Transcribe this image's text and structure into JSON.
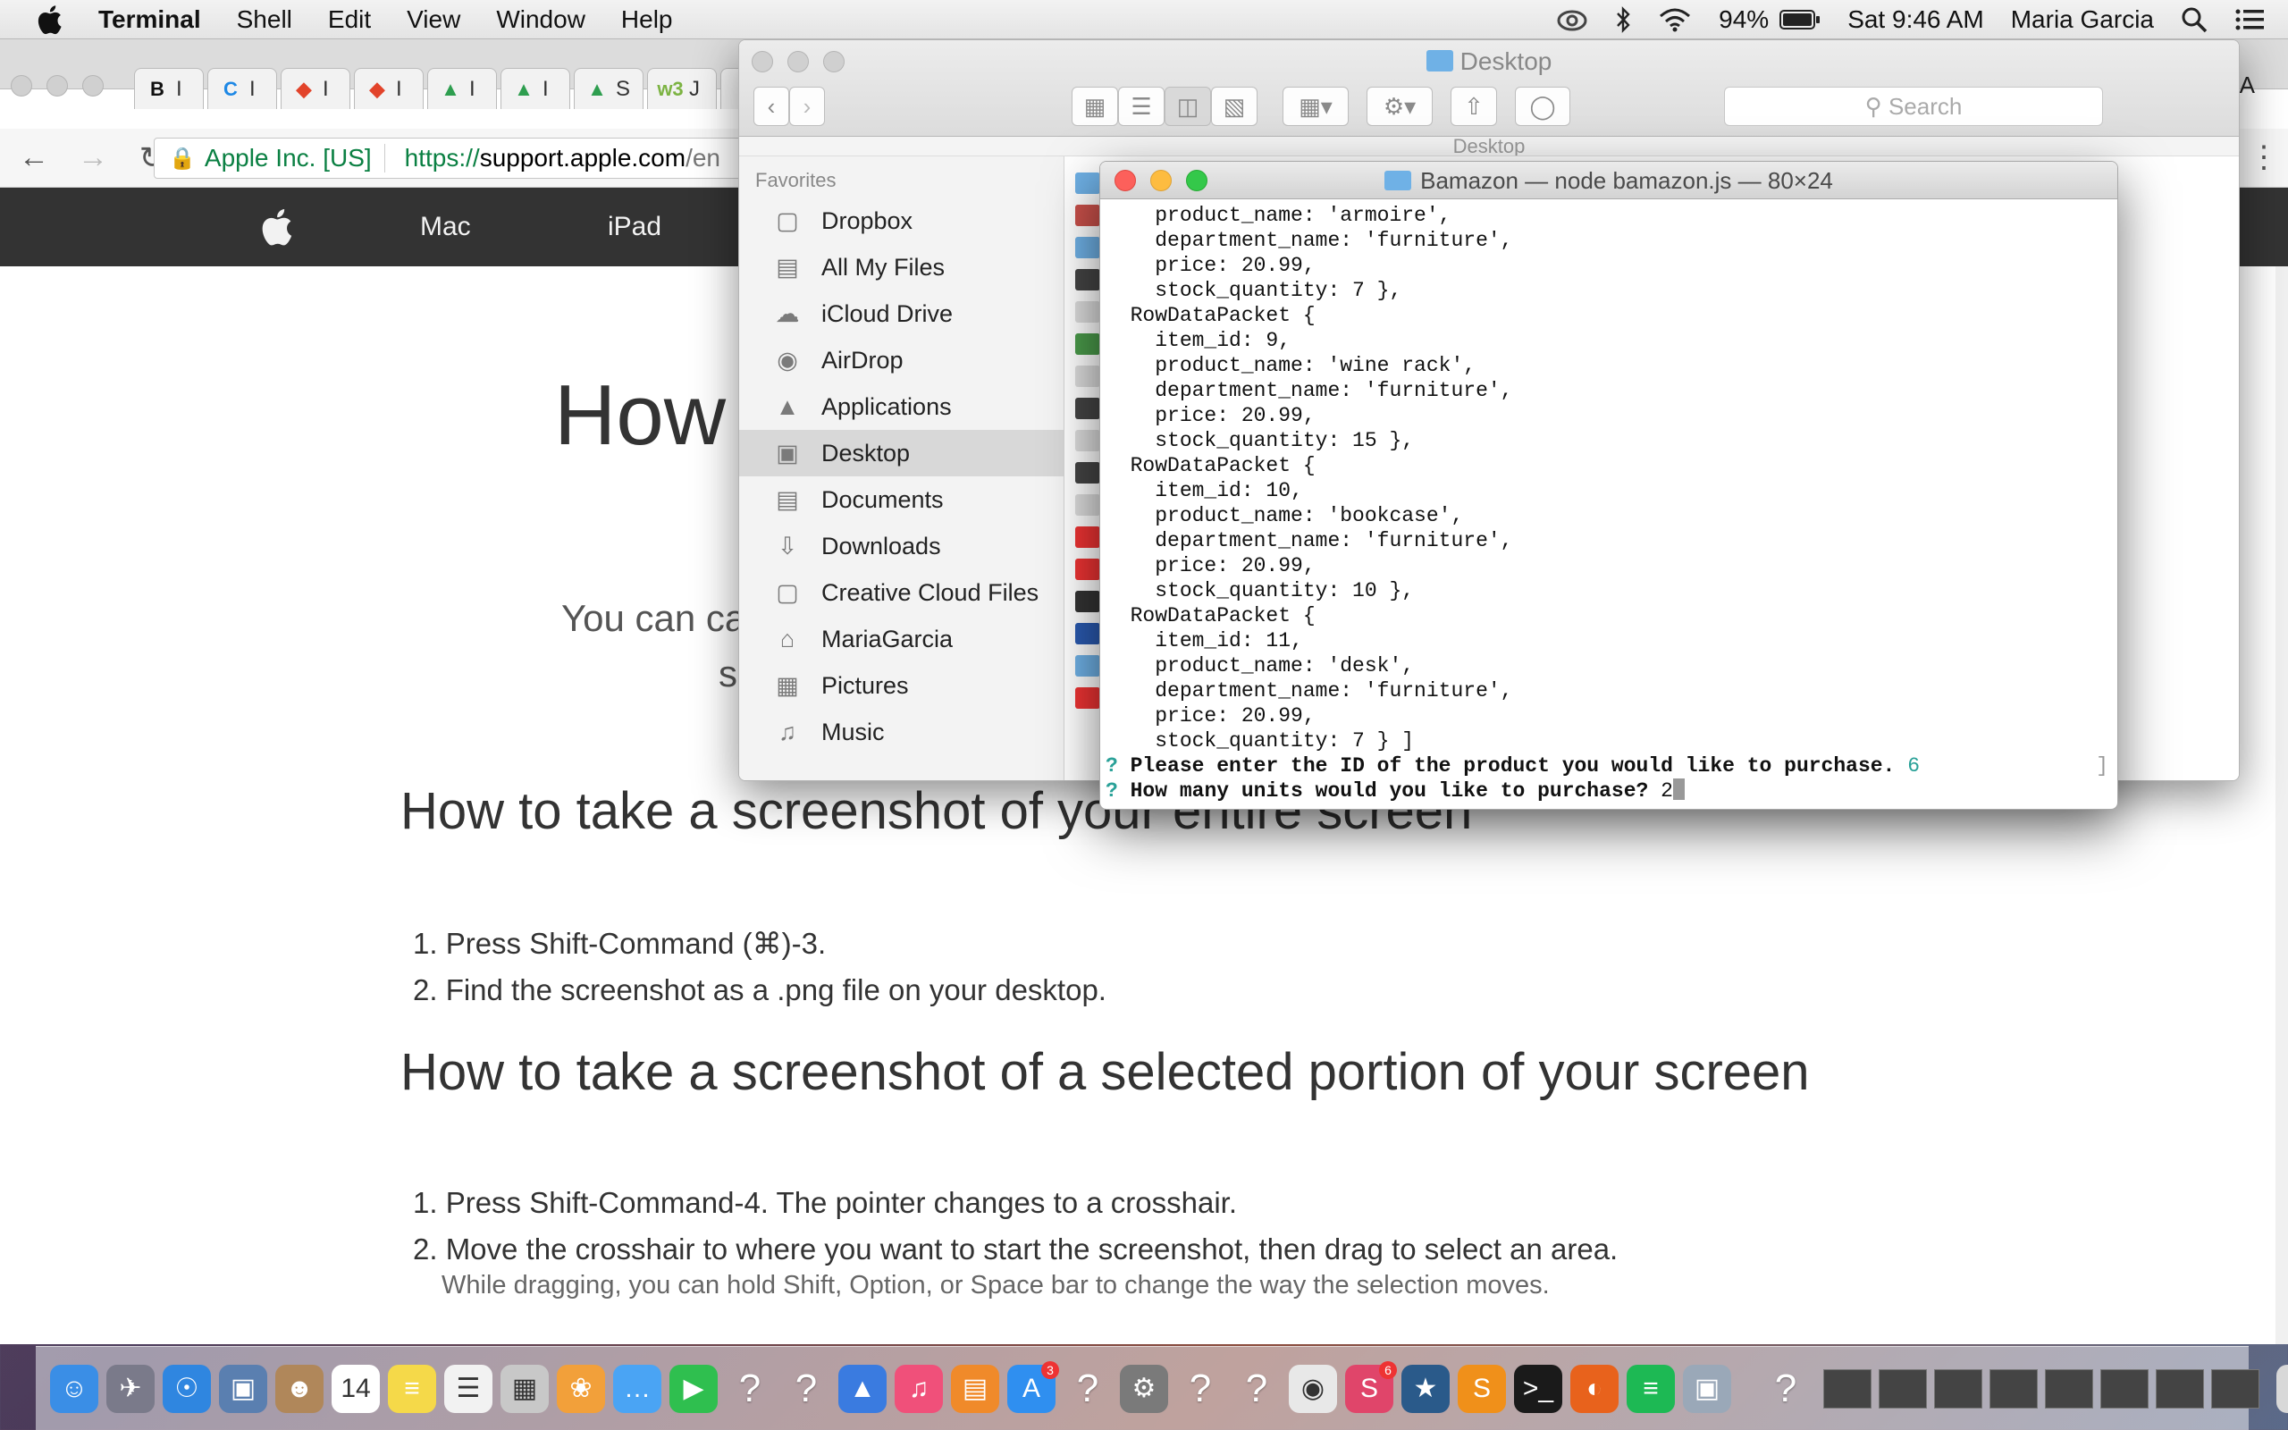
{
  "menubar": {
    "app": "Terminal",
    "menus": [
      "Shell",
      "Edit",
      "View",
      "Window",
      "Help"
    ],
    "battery": "94%",
    "clock": "Sat 9:46 AM",
    "user": "Maria Garcia"
  },
  "browser": {
    "tabs": [
      {
        "glyph": "B",
        "color": "#111111"
      },
      {
        "glyph": "C",
        "color": "#1e88e5"
      },
      {
        "glyph": "◆",
        "color": "#e2432a"
      },
      {
        "glyph": "◆",
        "color": "#e2432a"
      },
      {
        "glyph": "▲",
        "color": "#2e9e4f"
      },
      {
        "glyph": "▲",
        "color": "#2e9e4f"
      },
      {
        "glyph": "▲",
        "color": "#2e9e4f"
      },
      {
        "glyph": "w3",
        "color": "#7cb342"
      },
      {
        "glyph": "▮",
        "color": "#111111"
      }
    ],
    "tab_suffixes": [
      "I",
      "I",
      "I",
      "I",
      "I",
      "I",
      "S",
      "J",
      ""
    ],
    "profile": "MARIA",
    "omnibox": {
      "org": "Apple Inc. [US]",
      "proto": "https://",
      "host": "support.apple.com",
      "path": "/en"
    },
    "applenav": {
      "items": [
        "Mac",
        "iPad"
      ]
    },
    "article": {
      "title": "How",
      "intro_line1": "You can ca",
      "intro_line2": "s",
      "heading1": "How to take a screenshot of your entire screen",
      "list1": [
        "1. Press Shift-Command (⌘)-3.",
        "2. Find the screenshot as a .png file on your desktop."
      ],
      "heading2": "How to take a screenshot of a selected portion of your screen",
      "list2": [
        "1. Press Shift-Command-4. The pointer changes to a crosshair.",
        "2. Move the crosshair to where you want to start the screenshot, then drag to select an area."
      ],
      "note": "While dragging, you can hold Shift, Option, or Space bar to change the way the selection moves."
    }
  },
  "finder": {
    "title": "Desktop",
    "path_label": "Desktop",
    "search_placeholder": "Search",
    "sidebar_header": "Favorites",
    "items": [
      "Dropbox",
      "All My Files",
      "iCloud Drive",
      "AirDrop",
      "Applications",
      "Desktop",
      "Documents",
      "Downloads",
      "Creative Cloud Files",
      "MariaGarcia",
      "Pictures",
      "Music"
    ],
    "selected": "Desktop"
  },
  "terminal": {
    "title": "Bamazon — node bamazon.js — 80×24",
    "lines": [
      "    product_name: 'armoire',",
      "    department_name: 'furniture',",
      "    price: 20.99,",
      "    stock_quantity: 7 },",
      "  RowDataPacket {",
      "    item_id: 9,",
      "    product_name: 'wine rack',",
      "    department_name: 'furniture',",
      "    price: 20.99,",
      "    stock_quantity: 15 },",
      "  RowDataPacket {",
      "    item_id: 10,",
      "    product_name: 'bookcase',",
      "    department_name: 'furniture',",
      "    price: 20.99,",
      "    stock_quantity: 10 },",
      "  RowDataPacket {",
      "    item_id: 11,",
      "    product_name: 'desk',",
      "    department_name: 'furniture',",
      "    price: 20.99,",
      "    stock_quantity: 7 } ]"
    ],
    "prompt1_marker": "?",
    "prompt1_text": "Please enter the ID of the product you would like to purchase.",
    "prompt1_answer": "6",
    "prompt2_marker": "?",
    "prompt2_text": "How many units would you like to purchase?",
    "prompt2_answer": "2"
  },
  "dock": {
    "apps": [
      {
        "name": "finder",
        "glyph": "☺",
        "bg": "#3a8ee6"
      },
      {
        "name": "launchpad",
        "glyph": "✈",
        "bg": "#7a7a8a"
      },
      {
        "name": "safari",
        "glyph": "☉",
        "bg": "#2f86e0"
      },
      {
        "name": "preview",
        "glyph": "▣",
        "bg": "#5a7fb0"
      },
      {
        "name": "contacts",
        "glyph": "☻",
        "bg": "#b0875a"
      },
      {
        "name": "calendar",
        "glyph": "14",
        "bg": "#ffffff"
      },
      {
        "name": "notes",
        "glyph": "≡",
        "bg": "#f5d949"
      },
      {
        "name": "reminders",
        "glyph": "☰",
        "bg": "#f2f2f2"
      },
      {
        "name": "photo-booth",
        "glyph": "▦",
        "bg": "#c8c8c8"
      },
      {
        "name": "photos",
        "glyph": "❀",
        "bg": "#f2a03a"
      },
      {
        "name": "messages",
        "glyph": "…",
        "bg": "#4aa4f4"
      },
      {
        "name": "facetime",
        "glyph": "▶",
        "bg": "#2fbf4f"
      },
      {
        "name": "unknown-1",
        "glyph": "?",
        "bg": "transparent"
      },
      {
        "name": "unknown-2",
        "glyph": "?",
        "bg": "transparent"
      },
      {
        "name": "keynote",
        "glyph": "▲",
        "bg": "#3a7be0"
      },
      {
        "name": "itunes",
        "glyph": "♫",
        "bg": "#f0507a"
      },
      {
        "name": "ibooks",
        "glyph": "▤",
        "bg": "#f08a2a"
      },
      {
        "name": "app-store",
        "glyph": "A",
        "bg": "#2f8ff0",
        "badge": "3"
      },
      {
        "name": "unknown-3",
        "glyph": "?",
        "bg": "transparent"
      },
      {
        "name": "system-preferences",
        "glyph": "⚙",
        "bg": "#7a7a7a"
      },
      {
        "name": "unknown-4",
        "glyph": "?",
        "bg": "transparent"
      },
      {
        "name": "unknown-5",
        "glyph": "?",
        "bg": "transparent"
      },
      {
        "name": "chrome",
        "glyph": "◉",
        "bg": "#e8e8e8"
      },
      {
        "name": "slack",
        "glyph": "S",
        "bg": "#e0456a",
        "badge": "6"
      },
      {
        "name": "mysql-workbench",
        "glyph": "★",
        "bg": "#2a5a8a"
      },
      {
        "name": "sublime-text",
        "glyph": "S",
        "bg": "#f0901a"
      },
      {
        "name": "terminal",
        "glyph": ">_",
        "bg": "#1a1a1a"
      },
      {
        "name": "firefox",
        "glyph": "◐",
        "bg": "#e8621c"
      },
      {
        "name": "spotify",
        "glyph": "≡",
        "bg": "#1db954"
      },
      {
        "name": "image-capture",
        "glyph": "▣",
        "bg": "#9aa8b8"
      }
    ],
    "after_sep": [
      {
        "name": "unknown-6",
        "glyph": "?",
        "bg": "transparent"
      }
    ],
    "thumbnail_count": 8
  }
}
